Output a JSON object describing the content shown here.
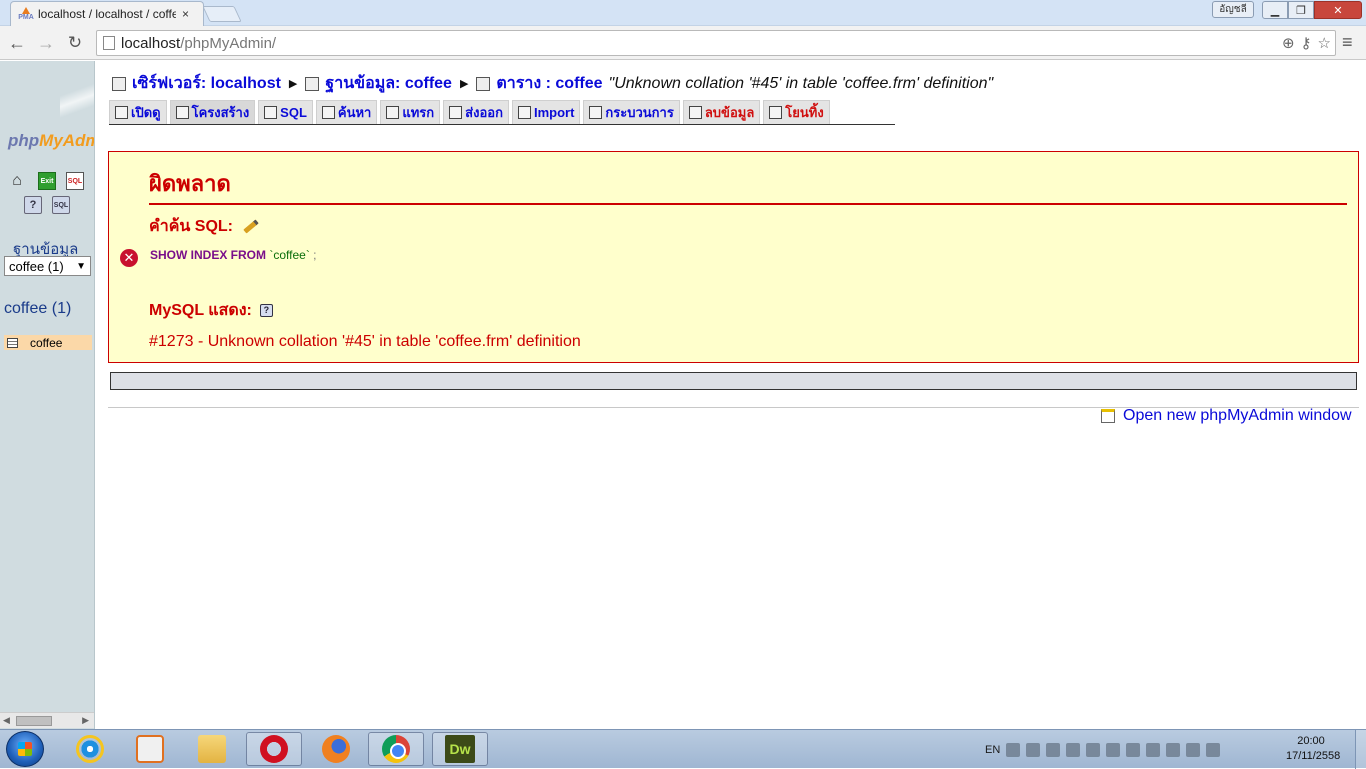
{
  "browser": {
    "tab_title": "localhost / localhost / coffee",
    "tab_favicon_text": "PMA",
    "tab_close": "×",
    "user_badge": "อัญชลี",
    "url_host": "localhost",
    "url_path": "/phpMyAdmin/",
    "icons": [
      "back-icon",
      "forward-icon",
      "reload-icon",
      "zoom-icon",
      "key-icon",
      "star-icon",
      "menu-icon"
    ]
  },
  "nav": {
    "logo_php": "php",
    "logo_my": "MyAdmin",
    "database_label": "ฐานข้อมูล",
    "database_select_value": "coffee (1)",
    "current_db": "coffee (1)",
    "tables": [
      "coffee"
    ]
  },
  "breadcrumb": {
    "server_label": "เซิร์ฟเวอร์: localhost",
    "database_label": "ฐานข้อมูล: coffee",
    "table_label": "ตาราง : coffee",
    "message": "\"Unknown collation '#45' in table 'coffee.frm' definition\""
  },
  "tabs": [
    {
      "label": "เปิดดู",
      "style": "normal"
    },
    {
      "label": "โครงสร้าง",
      "style": "active"
    },
    {
      "label": "SQL",
      "style": "normal"
    },
    {
      "label": "ค้นหา",
      "style": "normal"
    },
    {
      "label": "แทรก",
      "style": "normal"
    },
    {
      "label": "ส่งออก",
      "style": "normal"
    },
    {
      "label": "Import",
      "style": "normal"
    },
    {
      "label": "กระบวนการ",
      "style": "normal"
    },
    {
      "label": "ลบข้อมูล",
      "style": "red"
    },
    {
      "label": "โยนทิ้ง",
      "style": "red"
    }
  ],
  "error": {
    "title": "ผิดพลาด",
    "sql_label": "คำค้น SQL:",
    "sql_keyword": "SHOW INDEX FROM",
    "sql_identifier": "`coffee`",
    "sql_semicolon": ";",
    "mysql_label": "MySQL แสดง:",
    "help_icon": "?",
    "message": "#1273 - Unknown collation '#45' in table 'coffee.frm' definition"
  },
  "footer": {
    "new_window_link": "Open new phpMyAdmin window"
  },
  "taskbar": {
    "apps": [
      "internet-explorer",
      "media-player",
      "file-explorer",
      "opera",
      "firefox",
      "chrome",
      "dreamweaver"
    ],
    "dw_label": "Dw",
    "language": "EN",
    "time": "20:00",
    "date": "17/11/2558"
  }
}
